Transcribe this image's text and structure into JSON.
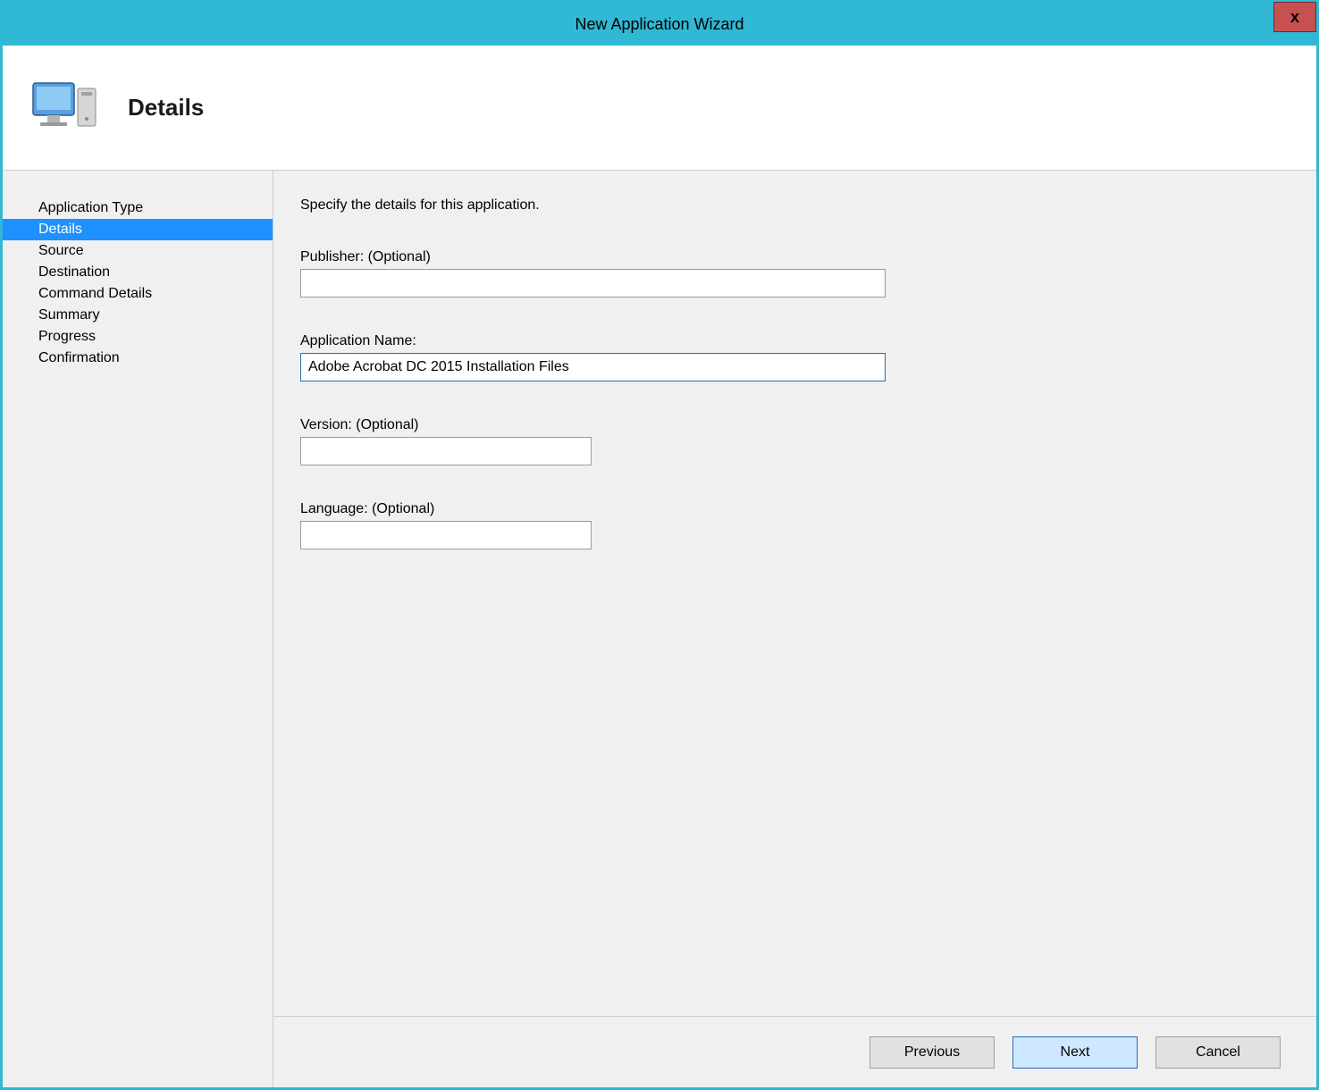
{
  "title": "New Application Wizard",
  "close": "x",
  "header": {
    "title": "Details"
  },
  "sidebar": {
    "items": [
      {
        "label": "Application Type",
        "active": false
      },
      {
        "label": "Details",
        "active": true
      },
      {
        "label": "Source",
        "active": false
      },
      {
        "label": "Destination",
        "active": false
      },
      {
        "label": "Command Details",
        "active": false
      },
      {
        "label": "Summary",
        "active": false
      },
      {
        "label": "Progress",
        "active": false
      },
      {
        "label": "Confirmation",
        "active": false
      }
    ]
  },
  "form": {
    "instruction": "Specify the details for this application.",
    "publisher": {
      "label": "Publisher: (Optional)",
      "value": ""
    },
    "appname": {
      "label": "Application Name:",
      "value": "Adobe Acrobat DC 2015 Installation Files"
    },
    "version": {
      "label": "Version: (Optional)",
      "value": ""
    },
    "language": {
      "label": "Language: (Optional)",
      "value": ""
    }
  },
  "buttons": {
    "previous": "Previous",
    "next": "Next",
    "cancel": "Cancel"
  }
}
